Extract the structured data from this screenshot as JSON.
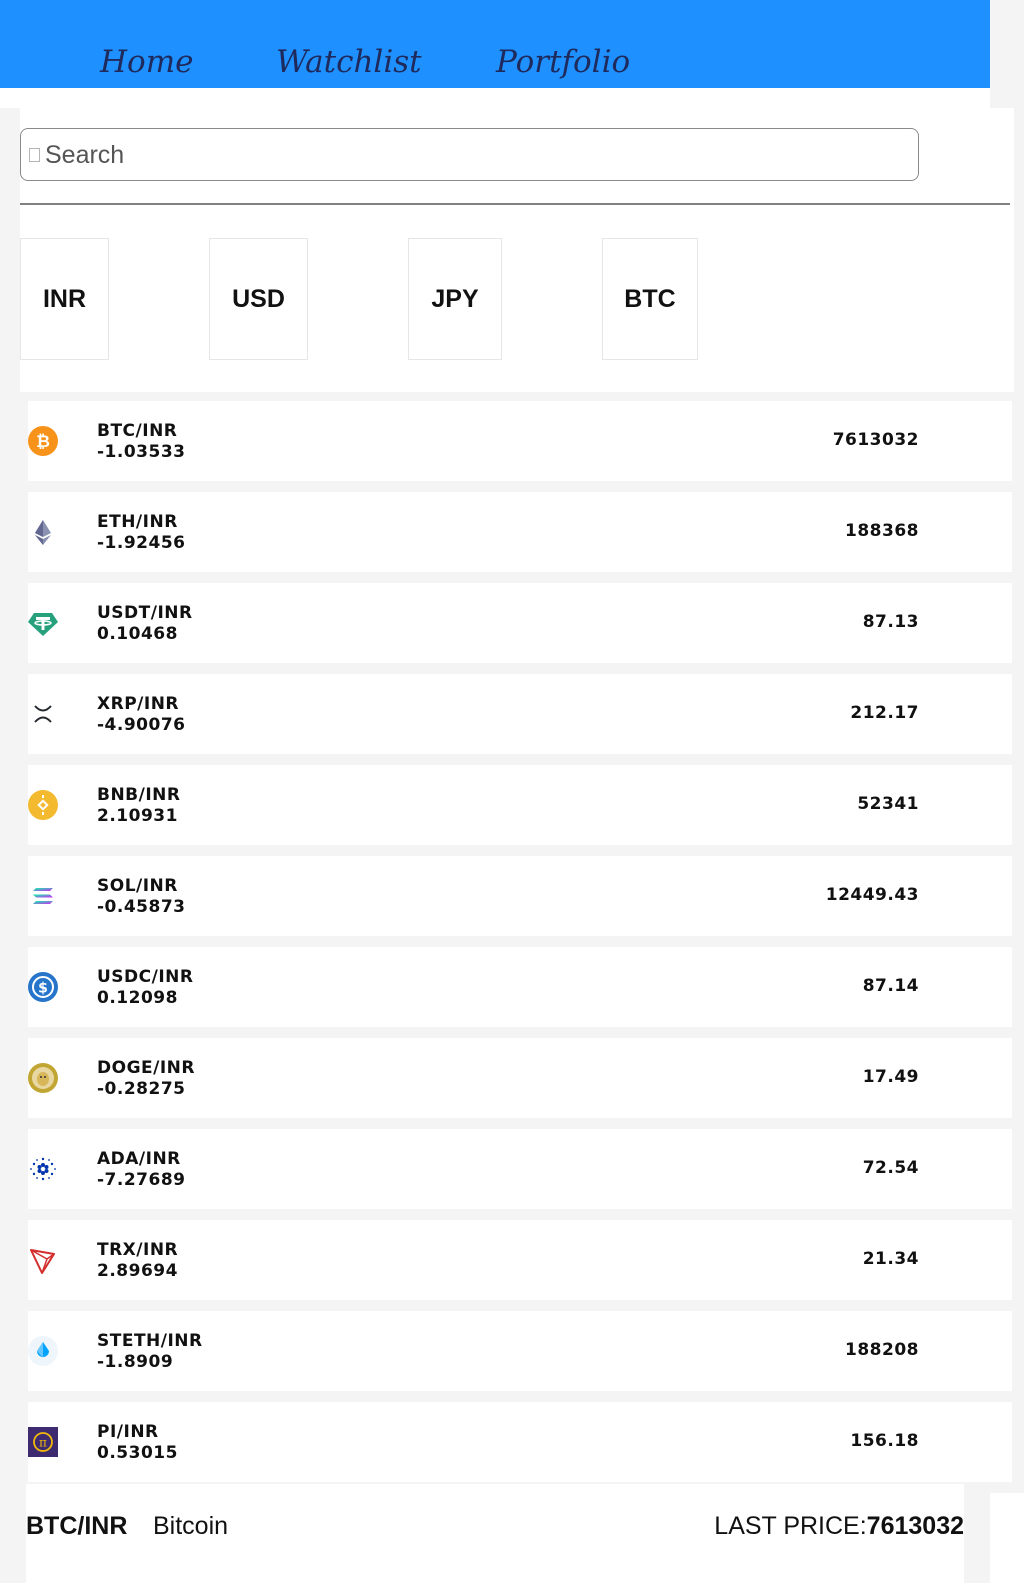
{
  "nav": {
    "home": "Home",
    "watchlist": "Watchlist",
    "portfolio": "Portfolio"
  },
  "search": {
    "placeholder": "Search"
  },
  "currencies": [
    "INR",
    "USD",
    "JPY",
    "BTC"
  ],
  "coins": [
    {
      "pair": "BTC/INR",
      "change": "-1.03533",
      "price": "7613032",
      "icon": "bitcoin-icon"
    },
    {
      "pair": "ETH/INR",
      "change": "-1.92456",
      "price": "188368",
      "icon": "ethereum-icon"
    },
    {
      "pair": "USDT/INR",
      "change": "0.10468",
      "price": "87.13",
      "icon": "tether-icon"
    },
    {
      "pair": "XRP/INR",
      "change": "-4.90076",
      "price": "212.17",
      "icon": "xrp-icon"
    },
    {
      "pair": "BNB/INR",
      "change": "2.10931",
      "price": "52341",
      "icon": "bnb-icon"
    },
    {
      "pair": "SOL/INR",
      "change": "-0.45873",
      "price": "12449.43",
      "icon": "solana-icon"
    },
    {
      "pair": "USDC/INR",
      "change": "0.12098",
      "price": "87.14",
      "icon": "usdc-icon"
    },
    {
      "pair": "DOGE/INR",
      "change": "-0.28275",
      "price": "17.49",
      "icon": "dogecoin-icon"
    },
    {
      "pair": "ADA/INR",
      "change": "-7.27689",
      "price": "72.54",
      "icon": "cardano-icon"
    },
    {
      "pair": "TRX/INR",
      "change": "2.89694",
      "price": "21.34",
      "icon": "tron-icon"
    },
    {
      "pair": "STETH/INR",
      "change": "-1.8909",
      "price": "188208",
      "icon": "steth-icon"
    },
    {
      "pair": "PI/INR",
      "change": "0.53015",
      "price": "156.18",
      "icon": "pi-network-icon"
    }
  ],
  "selected": {
    "pair": "BTC/INR",
    "name": "Bitcoin",
    "price_label": "LAST PRICE:",
    "price_value": "7613032"
  },
  "colors": {
    "nav_bg": "#1e90ff",
    "nav_text": "#1f2a5c",
    "page_bg": "#f4f4f4"
  }
}
